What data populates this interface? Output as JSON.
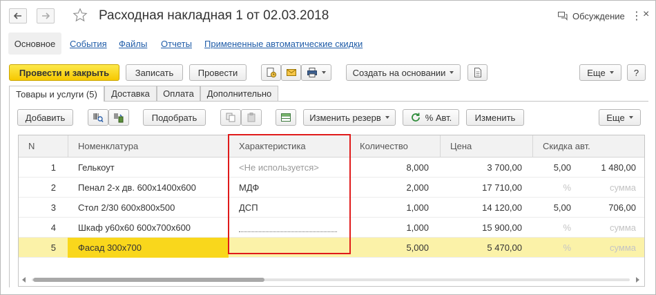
{
  "window": {
    "title": "Расходная накладная 1 от 02.03.2018",
    "discussion_label": "Обсуждение",
    "more_label": "⋮",
    "close_label": "×"
  },
  "sections": {
    "main": "Основное",
    "links": [
      "События",
      "Файлы",
      "Отчеты",
      "Примененные автоматические скидки"
    ]
  },
  "toolbar": {
    "post_close": "Провести и закрыть",
    "save": "Записать",
    "post": "Провести",
    "create_based_on": "Создать на основании",
    "more": "Еще",
    "help": "?"
  },
  "tabs": [
    "Товары и услуги (5)",
    "Доставка",
    "Оплата",
    "Дополнительно"
  ],
  "table_toolbar": {
    "add": "Добавить",
    "pick": "Подобрать",
    "change_reserve": "Изменить резерв",
    "auto_discount": "% Авт.",
    "change": "Изменить",
    "more": "Еще"
  },
  "table": {
    "columns": [
      "N",
      "Номенклатура",
      "Характеристика",
      "Количество",
      "Цена",
      "Скидка авт."
    ],
    "rows": [
      {
        "n": "1",
        "name": "Гелькоут",
        "char": "<Не используется>",
        "qty": "8,000",
        "price": "3 700,00",
        "pct": "5,00",
        "sum": "1 480,00"
      },
      {
        "n": "2",
        "name": "Пенал 2-х дв. 600х1400х600",
        "char": "МДФ",
        "qty": "2,000",
        "price": "17 710,00",
        "pct": "%",
        "sum": "сумма"
      },
      {
        "n": "3",
        "name": "Стол 2/30 600х800х500",
        "char": "ДСП",
        "qty": "1,000",
        "price": "14 120,00",
        "pct": "5,00",
        "sum": "706,00"
      },
      {
        "n": "4",
        "name": "Шкаф у60х60 600х700х600",
        "char": "",
        "qty": "1,000",
        "price": "15 900,00",
        "pct": "%",
        "sum": "сумма"
      },
      {
        "n": "5",
        "name": "Фасад 300х700",
        "char": "",
        "qty": "5,000",
        "price": "5 470,00",
        "pct": "%",
        "sum": "сумма"
      }
    ]
  },
  "colors": {
    "primary_button": "#f6c800",
    "selected_row": "#fbf2a8",
    "selected_cell": "#f9d71c",
    "highlight_frame": "#e01a1a",
    "link": "#1f5ca8"
  }
}
